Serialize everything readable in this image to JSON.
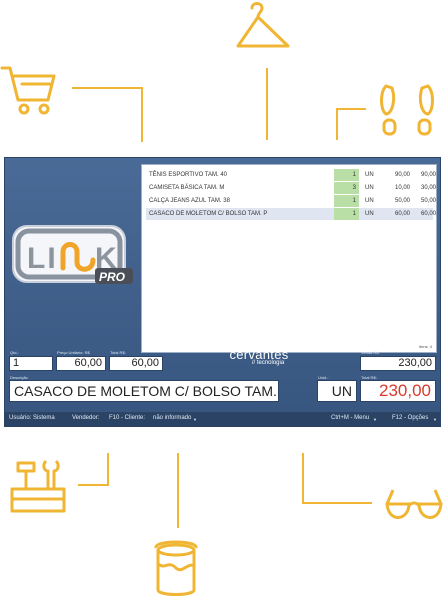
{
  "items": [
    {
      "name": "TÊNIS ESPORTIVO TAM. 40",
      "qty": "1",
      "unit": "UN",
      "price": "90,00",
      "total": "90,00"
    },
    {
      "name": "CAMISETA BÁSICA TAM. M",
      "qty": "3",
      "unit": "UN",
      "price": "10,00",
      "total": "30,00"
    },
    {
      "name": "CALÇA JEANS AZUL TAM. 38",
      "qty": "1",
      "unit": "UN",
      "price": "50,00",
      "total": "50,00"
    },
    {
      "name": "CASACO DE MOLETOM C/ BOLSO TAM. P",
      "qty": "1",
      "unit": "UN",
      "price": "60,00",
      "total": "60,00"
    }
  ],
  "items_count_label": "Itens: 4",
  "fields": {
    "qtd_label": "Qtd.:",
    "qtd_value": "1",
    "unit_price_label": "Preço Unitário: R$",
    "unit_price_value": "60,00",
    "total_label": "Total R$:",
    "total_value": "60,00",
    "venda_label": "Venda R$:",
    "venda_value": "230,00",
    "descricao_label": "Descrição",
    "descricao_value": "CASACO DE MOLETOM C/ BOLSO TAM. P",
    "unid_label": "Unid.:",
    "unid_value": "UN",
    "grand_total_label": "Total R$:",
    "grand_total_value": "230,00"
  },
  "brand": {
    "main": "cervantes",
    "sub": "// tecnologia"
  },
  "logo": {
    "text": "LINK",
    "badge": "PRO"
  },
  "status": {
    "usuario": "Usuário: Sistema",
    "vendedor": "Vendedor:",
    "cliente": "F10 - Cliente:",
    "cliente_value": "não informado",
    "menu": "Ctrl+M - Menu",
    "opcoes": "F12 - Opções"
  },
  "icons": [
    "cart-icon",
    "hanger-icon",
    "footprints-icon",
    "toolbox-icon",
    "paint-bucket-icon",
    "glasses-icon"
  ],
  "accent_color": "#f0b533"
}
